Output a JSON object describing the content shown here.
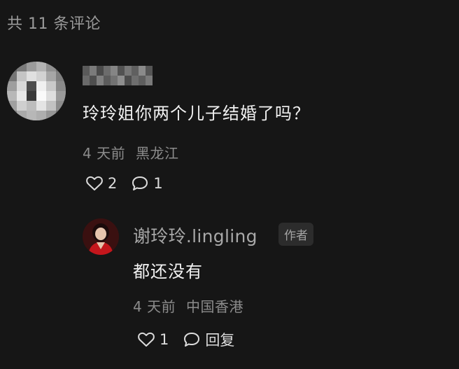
{
  "header": {
    "count_label": "共 11 条评论"
  },
  "comment": {
    "text": "玲玲姐你两个儿子结婚了吗？",
    "time": "4 天前",
    "location": "黑龙江",
    "like_count": "2",
    "reply_count": "1"
  },
  "reply": {
    "username": "谢玲玲.lingling",
    "badge": "作者",
    "text": "都还没有",
    "time": "4 天前",
    "location": "中国香港",
    "like_count": "1",
    "reply_label": "回复"
  },
  "colors": {
    "background": "#161616",
    "text_primary": "#f2f2f2",
    "text_secondary": "#8c8c8c"
  },
  "icons": {
    "like": "heart-outline-icon",
    "comment": "speech-bubble-icon"
  }
}
